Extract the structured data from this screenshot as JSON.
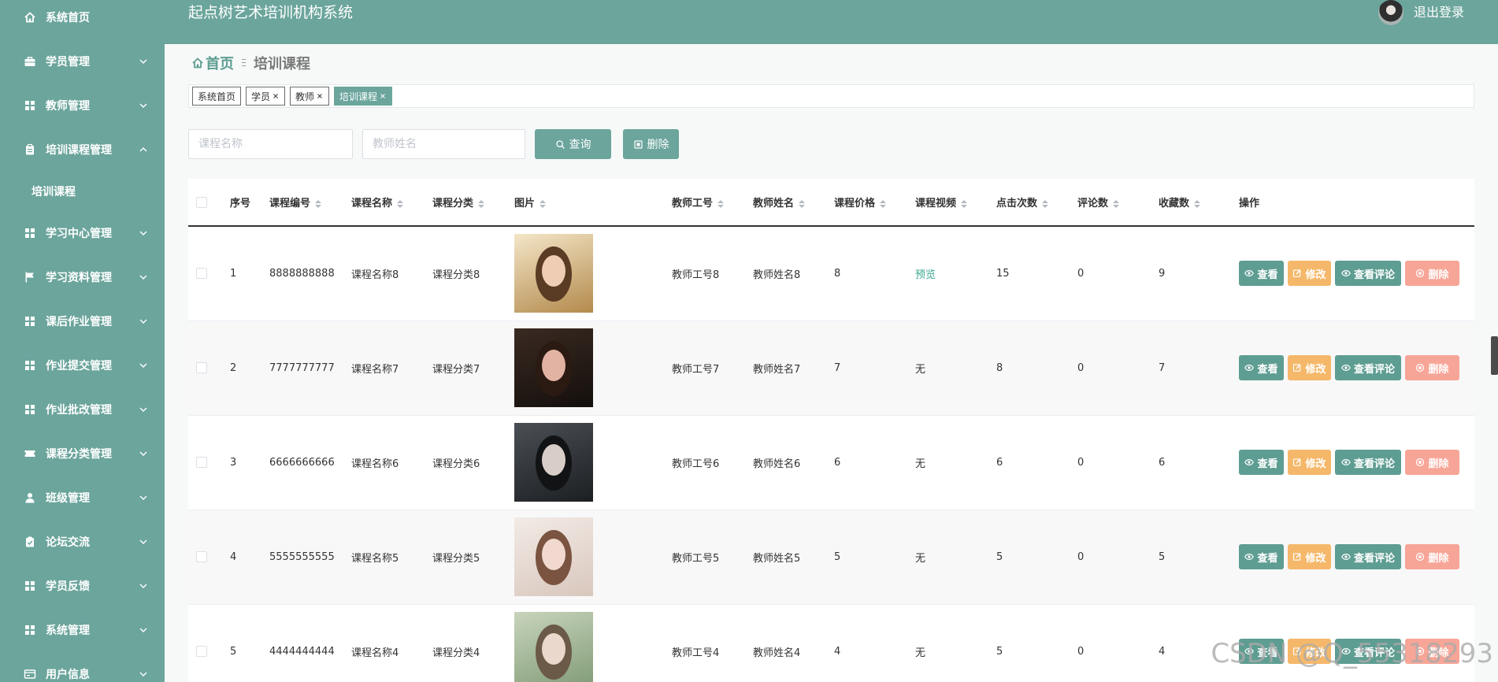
{
  "header": {
    "title": "起点树艺术培训机构系统",
    "logout_label": "退出登录"
  },
  "sidebar": {
    "items": [
      {
        "label": "系统首页",
        "icon": "home",
        "chevron": "none"
      },
      {
        "label": "学员管理",
        "icon": "briefcase",
        "chevron": "down"
      },
      {
        "label": "教师管理",
        "icon": "grid",
        "chevron": "down"
      },
      {
        "label": "培训课程管理",
        "icon": "clipboard",
        "chevron": "up",
        "children": [
          {
            "label": "培训课程"
          }
        ]
      },
      {
        "label": "学习中心管理",
        "icon": "grid",
        "chevron": "down"
      },
      {
        "label": "学习资料管理",
        "icon": "flag",
        "chevron": "down"
      },
      {
        "label": "课后作业管理",
        "icon": "grid",
        "chevron": "down"
      },
      {
        "label": "作业提交管理",
        "icon": "grid",
        "chevron": "down"
      },
      {
        "label": "作业批改管理",
        "icon": "grid",
        "chevron": "down"
      },
      {
        "label": "课程分类管理",
        "icon": "ticket",
        "chevron": "down"
      },
      {
        "label": "班级管理",
        "icon": "user",
        "chevron": "down"
      },
      {
        "label": "论坛交流",
        "icon": "clipboard-check",
        "chevron": "down"
      },
      {
        "label": "学员反馈",
        "icon": "grid",
        "chevron": "down"
      },
      {
        "label": "系统管理",
        "icon": "grid",
        "chevron": "down"
      },
      {
        "label": "用户信息",
        "icon": "id-card",
        "chevron": "down"
      }
    ]
  },
  "breadcrumb": {
    "home": "首页",
    "current": "培训课程"
  },
  "tabs": [
    {
      "label": "系统首页",
      "closable": false,
      "active": false
    },
    {
      "label": "学员",
      "closable": true,
      "active": false
    },
    {
      "label": "教师",
      "closable": true,
      "active": false
    },
    {
      "label": "培训课程",
      "closable": true,
      "active": true
    }
  ],
  "search": {
    "course_name_placeholder": "课程名称",
    "teacher_name_placeholder": "教师姓名",
    "query_label": "查询",
    "delete_label": "删除"
  },
  "table": {
    "columns": [
      {
        "label": "序号",
        "sortable": false
      },
      {
        "label": "课程编号",
        "sortable": true
      },
      {
        "label": "课程名称",
        "sortable": true
      },
      {
        "label": "课程分类",
        "sortable": true
      },
      {
        "label": "图片",
        "sortable": true
      },
      {
        "label": "教师工号",
        "sortable": true
      },
      {
        "label": "教师姓名",
        "sortable": true
      },
      {
        "label": "课程价格",
        "sortable": true
      },
      {
        "label": "课程视频",
        "sortable": true
      },
      {
        "label": "点击次数",
        "sortable": true
      },
      {
        "label": "评论数",
        "sortable": true
      },
      {
        "label": "收藏数",
        "sortable": true
      },
      {
        "label": "操作",
        "sortable": false
      }
    ],
    "rows": [
      {
        "index": "1",
        "code": "8888888888",
        "name": "课程名称8",
        "category": "课程分类8",
        "teacher_no": "教师工号8",
        "teacher_name": "教师姓名8",
        "price": "8",
        "video": "预览",
        "video_is_link": true,
        "clicks": "15",
        "comments": "0",
        "favorites": "9",
        "thumb_colors": [
          "#f4e6c8",
          "#b38a4c",
          "#efcdb4",
          "#5a3b24"
        ]
      },
      {
        "index": "2",
        "code": "7777777777",
        "name": "课程名称7",
        "category": "课程分类7",
        "teacher_no": "教师工号7",
        "teacher_name": "教师姓名7",
        "price": "7",
        "video": "无",
        "video_is_link": false,
        "clicks": "8",
        "comments": "0",
        "favorites": "7",
        "thumb_colors": [
          "#3a2a22",
          "#140f0c",
          "#e2b3a2",
          "#2a1a12"
        ]
      },
      {
        "index": "3",
        "code": "6666666666",
        "name": "课程名称6",
        "category": "课程分类6",
        "teacher_no": "教师工号6",
        "teacher_name": "教师姓名6",
        "price": "6",
        "video": "无",
        "video_is_link": false,
        "clicks": "6",
        "comments": "0",
        "favorites": "6",
        "thumb_colors": [
          "#4a4f55",
          "#1c1f22",
          "#d9cdc8",
          "#121314"
        ]
      },
      {
        "index": "4",
        "code": "5555555555",
        "name": "课程名称5",
        "category": "课程分类5",
        "teacher_no": "教师工号5",
        "teacher_name": "教师姓名5",
        "price": "5",
        "video": "无",
        "video_is_link": false,
        "clicks": "5",
        "comments": "0",
        "favorites": "5",
        "thumb_colors": [
          "#f3ebe6",
          "#d8c7bd",
          "#f1d9cf",
          "#7a5440"
        ]
      },
      {
        "index": "5",
        "code": "4444444444",
        "name": "课程名称4",
        "category": "课程分类4",
        "teacher_no": "教师工号4",
        "teacher_name": "教师姓名4",
        "price": "4",
        "video": "无",
        "video_is_link": false,
        "clicks": "5",
        "comments": "0",
        "favorites": "4",
        "thumb_colors": [
          "#c8d4bc",
          "#7f9a74",
          "#ead8cc",
          "#6b5a48"
        ]
      }
    ],
    "actions": {
      "view": "查看",
      "edit": "修改",
      "view_comments": "查看评论",
      "delete": "删除"
    }
  },
  "colors": {
    "primary": "#6ba59c",
    "action": "#5e9d92",
    "edit": "#f5b86a",
    "danger": "#f7a597",
    "link": "#3aa68f"
  },
  "watermark": "CSDN @Q_55318293"
}
